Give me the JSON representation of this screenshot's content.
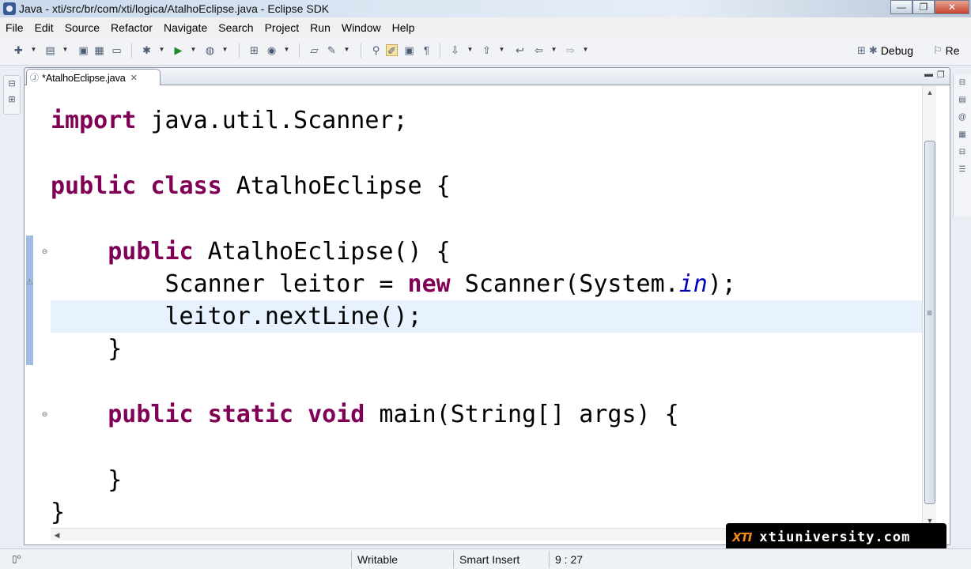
{
  "window": {
    "title": "Java - xti/src/br/com/xti/logica/AtalhoEclipse.java - Eclipse SDK",
    "minimize": "—",
    "maximize": "❐",
    "close": "✕"
  },
  "menu": [
    "File",
    "Edit",
    "Source",
    "Refactor",
    "Navigate",
    "Search",
    "Project",
    "Run",
    "Window",
    "Help"
  ],
  "perspectives": {
    "debug": "Debug",
    "other": "Re"
  },
  "editor": {
    "tab_label": "*AtalhoEclipse.java",
    "code": {
      "line1": {
        "kw": "import",
        "rest": " java.util.Scanner;"
      },
      "line3": {
        "kw1": "public",
        "kw2": "class",
        "rest": " AtalhoEclipse {"
      },
      "line5": {
        "indent": "    ",
        "kw": "public",
        "rest": " AtalhoEclipse() {"
      },
      "line6": {
        "a": "        Scanner leitor = ",
        "kw": "new",
        "b": " Scanner(System.",
        "field": "in",
        "c": ");"
      },
      "line7": {
        "text": "        leitor.nextLine();"
      },
      "line8": {
        "text": "    }"
      },
      "line10": {
        "indent": "    ",
        "kw1": "public",
        "kw2": "static",
        "kw3": "void",
        "rest": " main(String[] args) {"
      },
      "line12": {
        "text": "    }"
      },
      "line13": {
        "text": "}"
      }
    }
  },
  "watermark": {
    "logo": "XTI",
    "text": "xtiuniversity.com"
  },
  "status": {
    "writable": "Writable",
    "insert_mode": "Smart Insert",
    "position": "9 : 27"
  }
}
